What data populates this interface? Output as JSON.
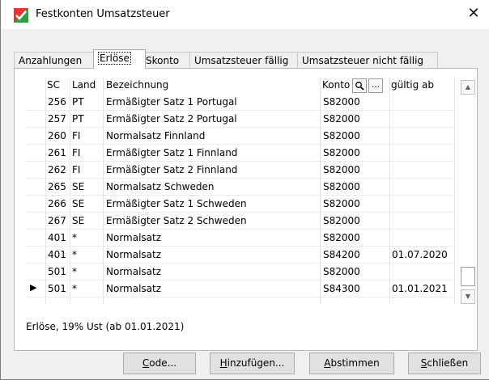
{
  "window": {
    "title": "Festkonten Umsatzsteuer",
    "close_glyph": "✕"
  },
  "tabs": [
    {
      "label": "Anzahlungen"
    },
    {
      "label": "Erlöse"
    },
    {
      "label": "Skonto"
    },
    {
      "label": "Umsatzsteuer fällig"
    },
    {
      "label": "Umsatzsteuer nicht fällig"
    }
  ],
  "grid": {
    "headers": {
      "sc": "SC",
      "land": "Land",
      "bezeichnung": "Bezeichnung",
      "konto": "Konto",
      "gueltig": "gültig ab"
    },
    "rows": [
      {
        "sc": "256",
        "land": "PT",
        "bezeichnung": "Ermäßigter Satz 1 Portugal",
        "konto": "S82000",
        "gueltig": ""
      },
      {
        "sc": "257",
        "land": "PT",
        "bezeichnung": "Ermäßigter Satz 2 Portugal",
        "konto": "S82000",
        "gueltig": ""
      },
      {
        "sc": "260",
        "land": "FI",
        "bezeichnung": "Normalsatz Finnland",
        "konto": "S82000",
        "gueltig": ""
      },
      {
        "sc": "261",
        "land": "FI",
        "bezeichnung": "Ermäßigter Satz 1 Finnland",
        "konto": "S82000",
        "gueltig": ""
      },
      {
        "sc": "262",
        "land": "FI",
        "bezeichnung": "Ermäßigter Satz 2 Finnland",
        "konto": "S82000",
        "gueltig": ""
      },
      {
        "sc": "265",
        "land": "SE",
        "bezeichnung": "Normalsatz Schweden",
        "konto": "S82000",
        "gueltig": ""
      },
      {
        "sc": "266",
        "land": "SE",
        "bezeichnung": "Ermäßigter Satz 1 Schweden",
        "konto": "S82000",
        "gueltig": ""
      },
      {
        "sc": "267",
        "land": "SE",
        "bezeichnung": "Ermäßigter Satz 2 Schweden",
        "konto": "S82000",
        "gueltig": ""
      },
      {
        "sc": "401",
        "land": "*",
        "bezeichnung": "Normalsatz",
        "konto": "S82000",
        "gueltig": ""
      },
      {
        "sc": "401",
        "land": "*",
        "bezeichnung": "Normalsatz",
        "konto": "S84200",
        "gueltig": "01.07.2020"
      },
      {
        "sc": "501",
        "land": "*",
        "bezeichnung": "Normalsatz",
        "konto": "S82000",
        "gueltig": ""
      },
      {
        "sc": "501",
        "land": "*",
        "bezeichnung": "Normalsatz",
        "konto": "S84300",
        "gueltig": "01.01.2021"
      }
    ],
    "current_row_marker": "▶"
  },
  "status_text": "Erlöse, 19% Ust (ab 01.01.2021)",
  "buttons": {
    "code": {
      "mnemonic": "C",
      "rest": "ode..."
    },
    "hinzufuegen": {
      "mnemonic": "H",
      "rest": "inzufügen..."
    },
    "abstimmen": {
      "mnemonic": "A",
      "rest": "bstimmen"
    },
    "schliessen": {
      "mnemonic": "S",
      "rest": "chließen"
    }
  },
  "icons": {
    "app": "app-logo-icon",
    "search": "magnifier-icon",
    "more": "ellipsis-icon",
    "scroll_up": "scroll-up-icon",
    "scroll_down": "scroll-down-icon"
  },
  "colors": {
    "accent_green": "#2ea043",
    "accent_red": "#e03a2f"
  }
}
